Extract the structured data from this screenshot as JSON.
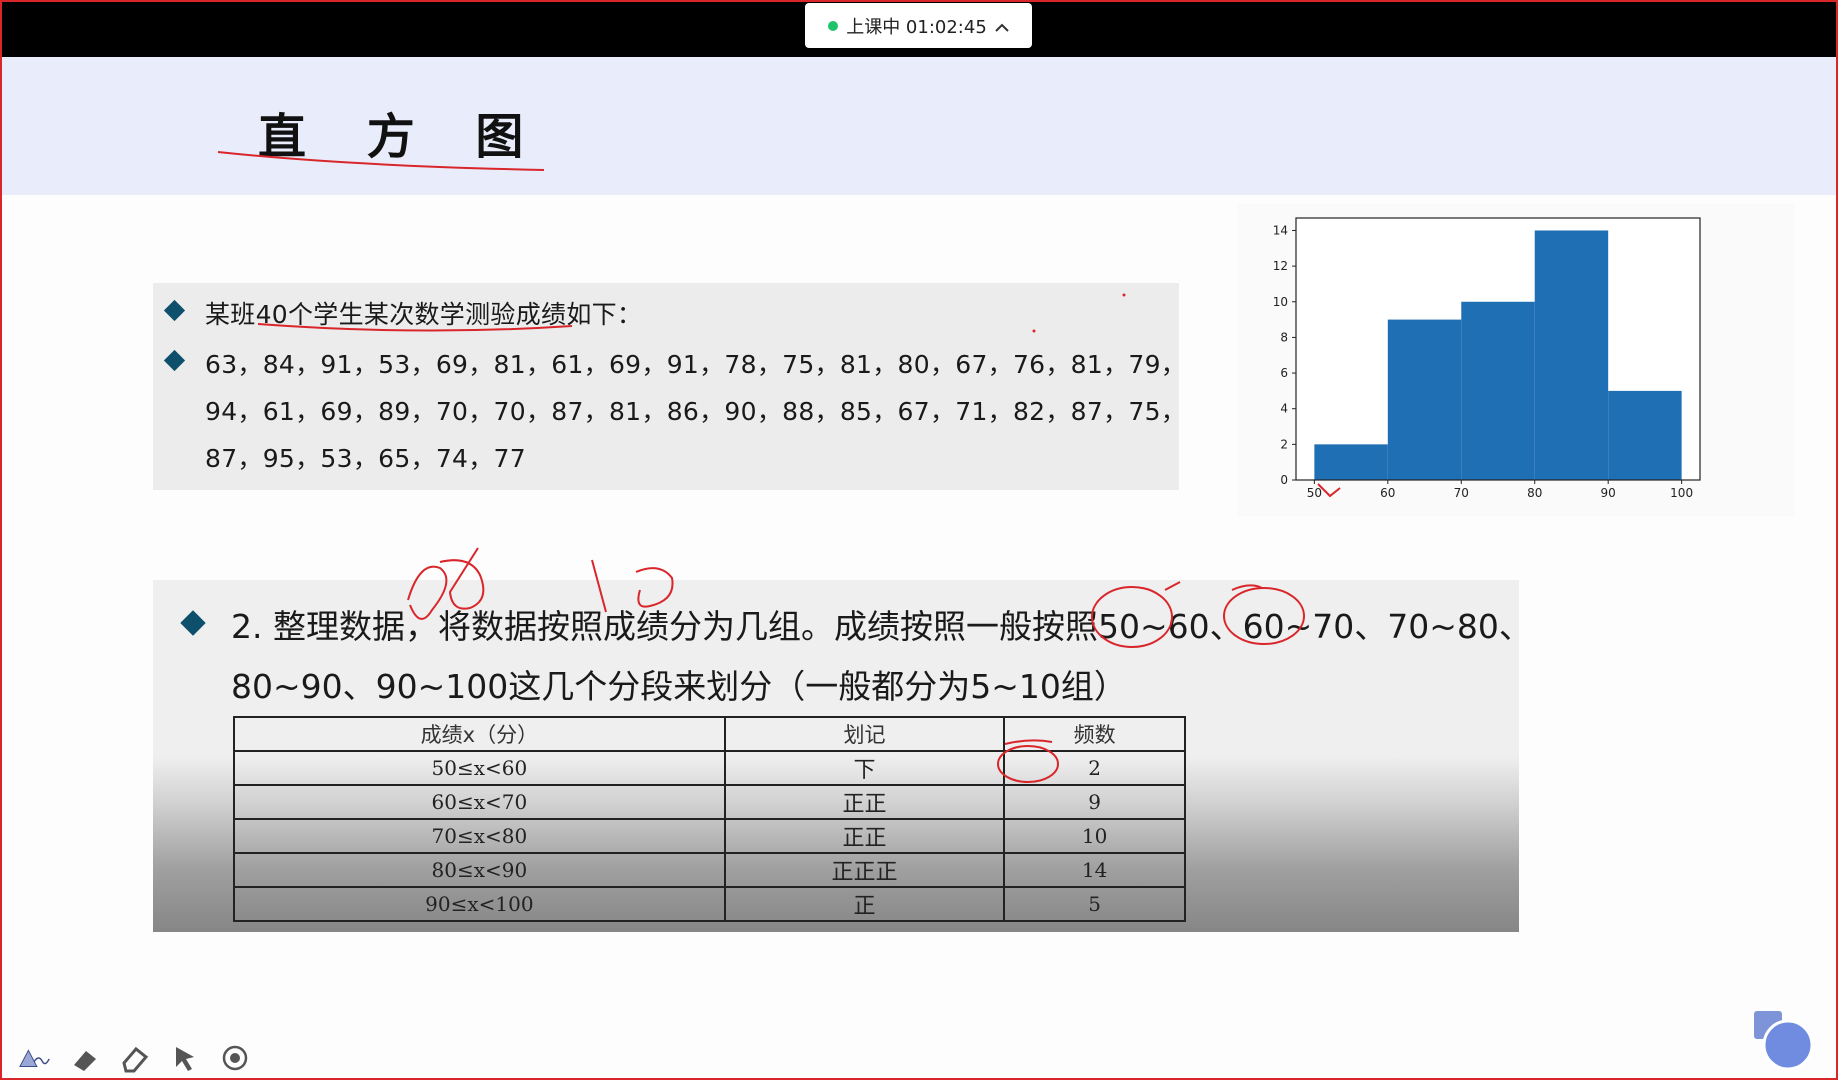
{
  "session": {
    "status_text": "上课中 01:02:45",
    "status_color": "#1fc46a"
  },
  "slide": {
    "title": "直 方 图",
    "intro": "某班40个学生某次数学测验成绩如下：",
    "scores_lines": [
      "63，84，91，53，69，81，61，69，91，78，75，81，80，67，76，81，79，",
      "94，61，69，89，70，70，87，81，86，90，88，85，67，71，82，87，75，",
      "87，95，53，65，74，77"
    ],
    "step_lines": [
      "2. 整理数据，将数据按照成绩分为几组。成绩按照一般按照50~60、60~70、70~80、",
      "80~90、90~100这几个分段来划分（一般都分为5~10组）"
    ],
    "table": {
      "headers": [
        "成绩x（分）",
        "划记",
        "频数"
      ],
      "rows": [
        [
          "50≤x<60",
          "下",
          "2"
        ],
        [
          "60≤x<70",
          "正正",
          "9"
        ],
        [
          "70≤x<80",
          "正正",
          "10"
        ],
        [
          "80≤x<90",
          "正正正",
          "14"
        ],
        [
          "90≤x<100",
          "正",
          "5"
        ]
      ]
    }
  },
  "chart_data": {
    "type": "bar",
    "bins": [
      [
        50,
        60
      ],
      [
        60,
        70
      ],
      [
        70,
        80
      ],
      [
        80,
        90
      ],
      [
        90,
        100
      ]
    ],
    "values": [
      2,
      9,
      10,
      14,
      5
    ],
    "xticks": [
      50,
      60,
      70,
      80,
      90,
      100
    ],
    "yticks": [
      0,
      2,
      4,
      6,
      8,
      10,
      12,
      14
    ],
    "xlim": [
      47.5,
      102.5
    ],
    "ylim": [
      0,
      14.7
    ],
    "bar_color": "#1f6fb4",
    "grid": false
  },
  "toolbar": {
    "tools": [
      "pen-icon",
      "highlighter-icon",
      "eraser-icon",
      "pointer-icon",
      "record-icon"
    ]
  },
  "colors": {
    "accent_red": "#d9262b",
    "diamond": "#0e4f6c",
    "title_band": "#e9edfb"
  }
}
